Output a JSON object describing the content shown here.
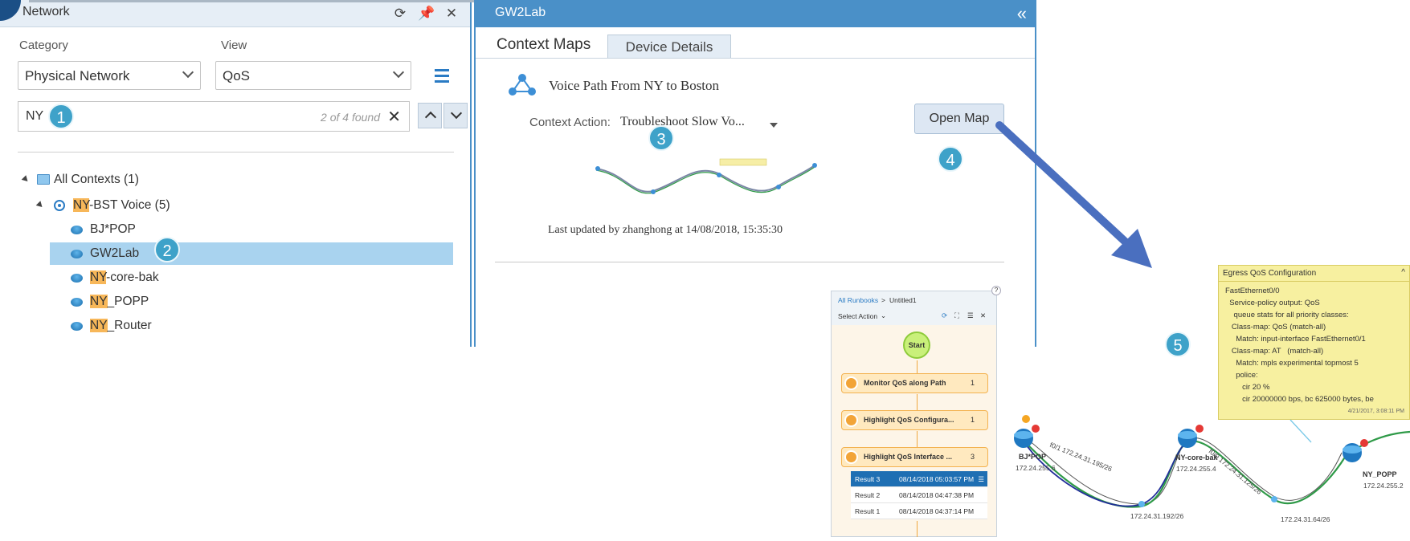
{
  "network": {
    "title": "Network",
    "category_label": "Category",
    "category_value": "Physical Network",
    "view_label": "View",
    "view_value": "QoS",
    "search_value": "NY",
    "search_count": "2 of 4 found",
    "tree": {
      "root": "All Contexts (1)",
      "context_hl": "NY",
      "context_rest": "-BST Voice (5)",
      "items": [
        {
          "hl": "",
          "rest": "BJ*POP"
        },
        {
          "hl": "",
          "rest": "GW2Lab"
        },
        {
          "hl": "NY",
          "rest": "-core-bak"
        },
        {
          "hl": "NY",
          "rest": "_POPP"
        },
        {
          "hl": "NY",
          "rest": "_Router"
        }
      ]
    }
  },
  "badges": [
    "1",
    "2",
    "3",
    "4",
    "5"
  ],
  "gw": {
    "title": "GW2Lab",
    "tab_context": "Context Maps",
    "tab_device": "Device Details",
    "map_title": "Voice Path From NY to Boston",
    "ctx_action_label": "Context Action:",
    "ctx_action_value": "Troubleshoot Slow Vo...",
    "open_map": "Open Map",
    "last_updated": "Last updated by zhanghong at 14/08/2018, 15:35:30"
  },
  "runbook": {
    "crumb_root": "All Runbooks",
    "crumb_sep": ">",
    "crumb_page": "Untitled1",
    "select_action": "Select Action",
    "start": "Start",
    "steps": [
      {
        "label": "Monitor QoS along Path",
        "count": "1"
      },
      {
        "label": "Highlight QoS Configura...",
        "count": "1"
      },
      {
        "label": "Highlight QoS Interface ...",
        "count": "3"
      }
    ],
    "results": [
      {
        "name": "Result 3",
        "time": "08/14/2018 05:03:57 PM"
      },
      {
        "name": "Result 2",
        "time": "08/14/2018 04:47:38 PM"
      },
      {
        "name": "Result 1",
        "time": "08/14/2018 04:37:14 PM"
      }
    ]
  },
  "qos": {
    "title": "Egress QoS Configuration",
    "body": "FastEthernet0/0\n  Service-policy output: QoS\n    queue stats for all priority classes:\n   Class-map: QoS (match-all)\n     Match: input-interface FastEthernet0/1\n   Class-map: AT   (match-all)\n     Match: mpls experimental topmost 5\n     police:\n        cir 20 %\n        cir 20000000 bps, bc 625000 bytes, be",
    "date": "4/21/2017, 3:08:11 PM"
  },
  "topology": {
    "dev_bj": "BJ*POP",
    "ip_bj": "172.24.255.6",
    "dev_nycore": "NY-core-bak",
    "ip_nycore": "172.24.255.4",
    "dev_nypopp": "NY_POPP",
    "ip_nypopp": "172.24.255.2",
    "ip_mid1": "172.24.31.192/26",
    "ip_mid2": "172.24.31.64/26",
    "link1": "f0/1 172.24.31.195/26",
    "link2": "f0/0 172.24.31.125/26",
    "marker": "A"
  }
}
